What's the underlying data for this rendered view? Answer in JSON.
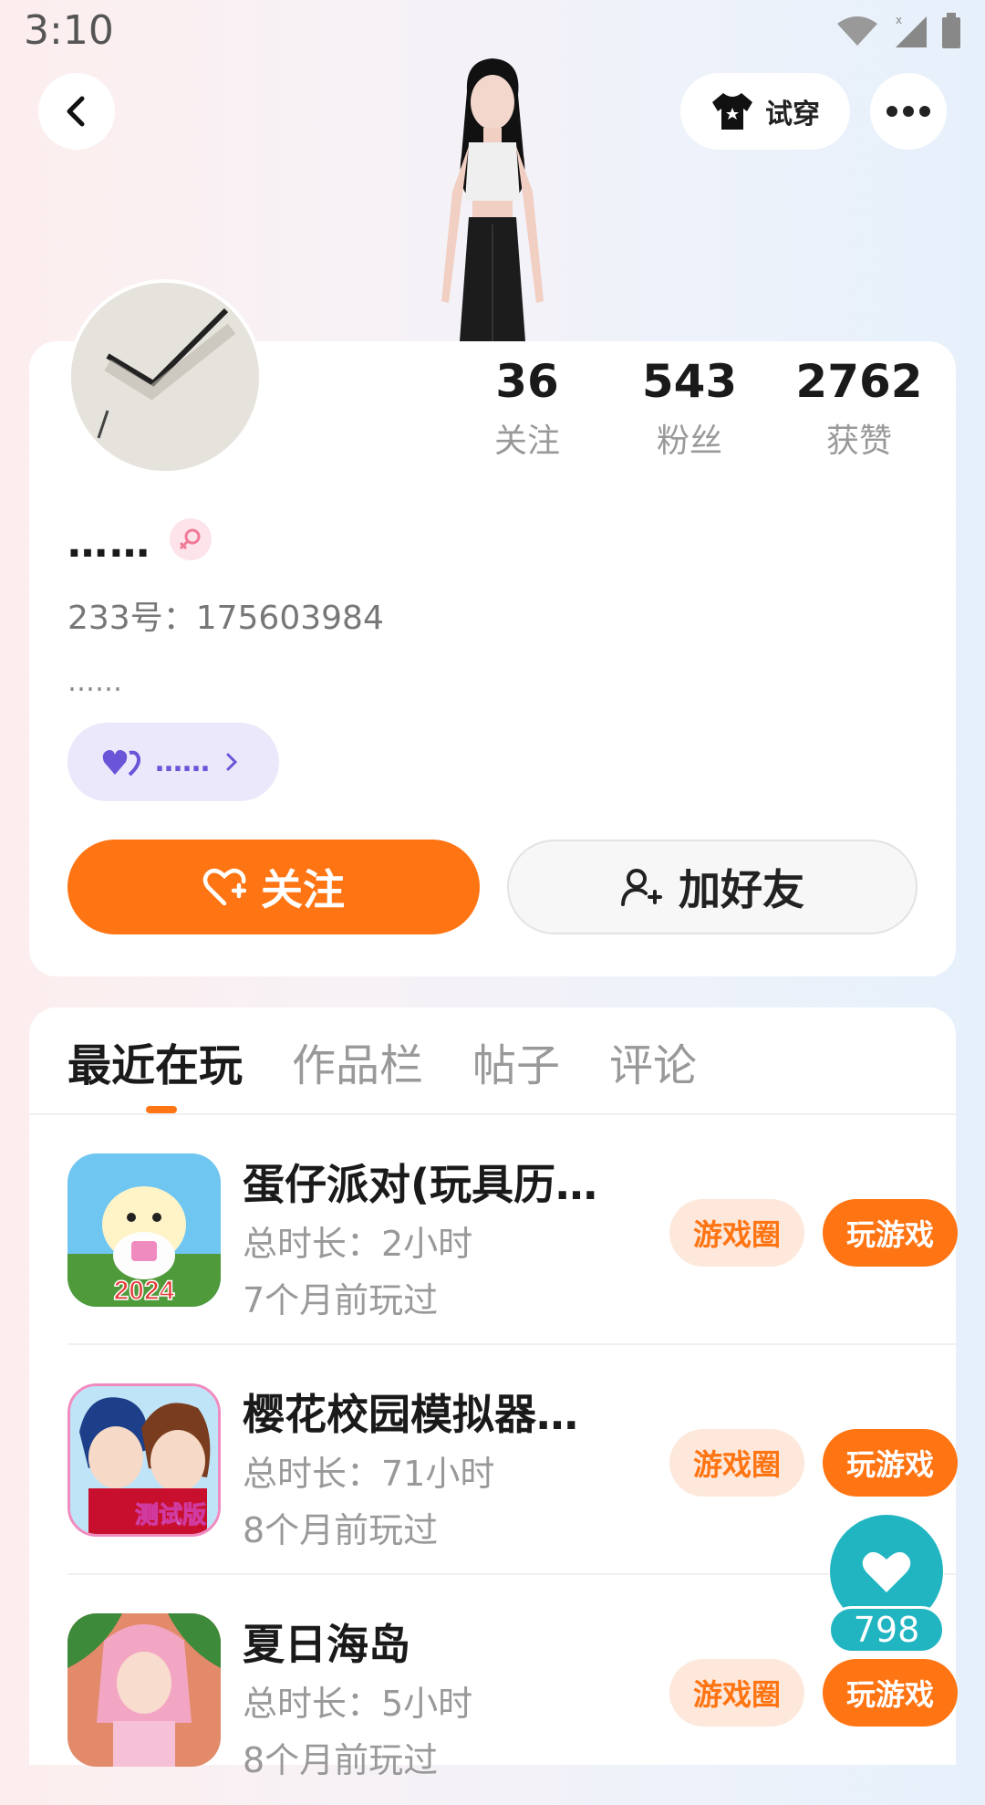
{
  "status_bar": {
    "time": "3:10"
  },
  "header": {
    "try_on_label": "试穿"
  },
  "profile": {
    "stats": [
      {
        "value": "36",
        "label": "关注"
      },
      {
        "value": "543",
        "label": "粉丝"
      },
      {
        "value": "2762",
        "label": "获赞"
      }
    ],
    "nickname": "……",
    "user_id": "233号：175603984",
    "bio": "……",
    "tag_label": "……",
    "follow_label": "关注",
    "add_friend_label": "加好友"
  },
  "tabs": [
    {
      "label": "最近在玩",
      "active": true
    },
    {
      "label": "作品栏",
      "active": false
    },
    {
      "label": "帖子",
      "active": false
    },
    {
      "label": "评论",
      "active": false
    }
  ],
  "games": [
    {
      "title": "蛋仔派对(玩具历…",
      "duration": "总时长：2小时",
      "last_played": "7个月前玩过",
      "circle_label": "游戏圈",
      "play_label": "玩游戏",
      "badge": "2024"
    },
    {
      "title": "樱花校园模拟器…",
      "duration": "总时长：71小时",
      "last_played": "8个月前玩过",
      "circle_label": "游戏圈",
      "play_label": "玩游戏",
      "badge": "测试版"
    },
    {
      "title": "夏日海岛",
      "duration": "总时长：5小时",
      "last_played": "8个月前玩过",
      "circle_label": "游戏圈",
      "play_label": "玩游戏",
      "badge": ""
    }
  ],
  "like_fab": {
    "count": "798"
  },
  "colors": {
    "accent": "#ff7413",
    "teal": "#21b5c2",
    "tag_purple": "#6a55d8"
  }
}
